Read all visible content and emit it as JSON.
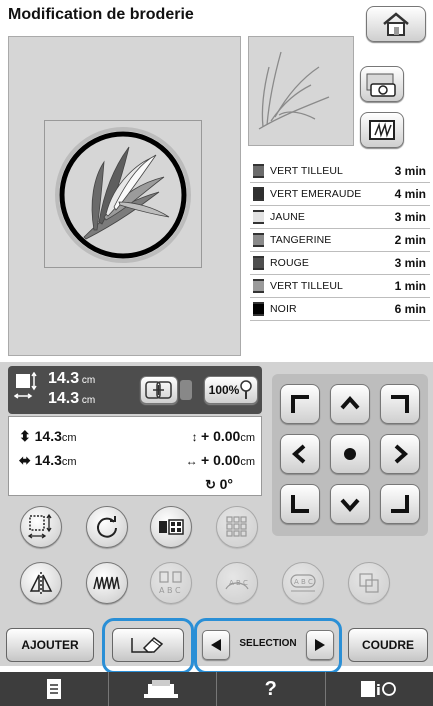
{
  "header": {
    "title": "Modification de broderie",
    "home_icon": "home-icon"
  },
  "threads": [
    {
      "color": "#6b6b6b",
      "name": "VERT TILLEUL",
      "time": "3",
      "unit": "min"
    },
    {
      "color": "#2f2f2f",
      "name": "VERT EMERAUDE",
      "time": "4",
      "unit": "min"
    },
    {
      "color": "#e2e2e2",
      "name": "JAUNE",
      "time": "3",
      "unit": "min"
    },
    {
      "color": "#8a8a8a",
      "name": "TANGERINE",
      "time": "2",
      "unit": "min"
    },
    {
      "color": "#4e4e4e",
      "name": "ROUGE",
      "time": "3",
      "unit": "min"
    },
    {
      "color": "#9a9a9a",
      "name": "VERT TILLEUL",
      "time": "1",
      "unit": "min"
    },
    {
      "color": "#000000",
      "name": "NOIR",
      "time": "6",
      "unit": "min"
    }
  ],
  "size_info": {
    "width": "14.3",
    "height": "14.3",
    "unit": "cm",
    "zoom": "100%"
  },
  "position_info": {
    "size_h": "14.3",
    "size_w": "14.3",
    "size_unit": "cm",
    "offset_v": "+ 0.00",
    "offset_h": "+ 0.00",
    "offset_unit": "cm",
    "rotation": "0°"
  },
  "buttons": {
    "add": "AJOUTER",
    "selection": "SELECTION",
    "sew": "COUDRE",
    "help": "?"
  }
}
